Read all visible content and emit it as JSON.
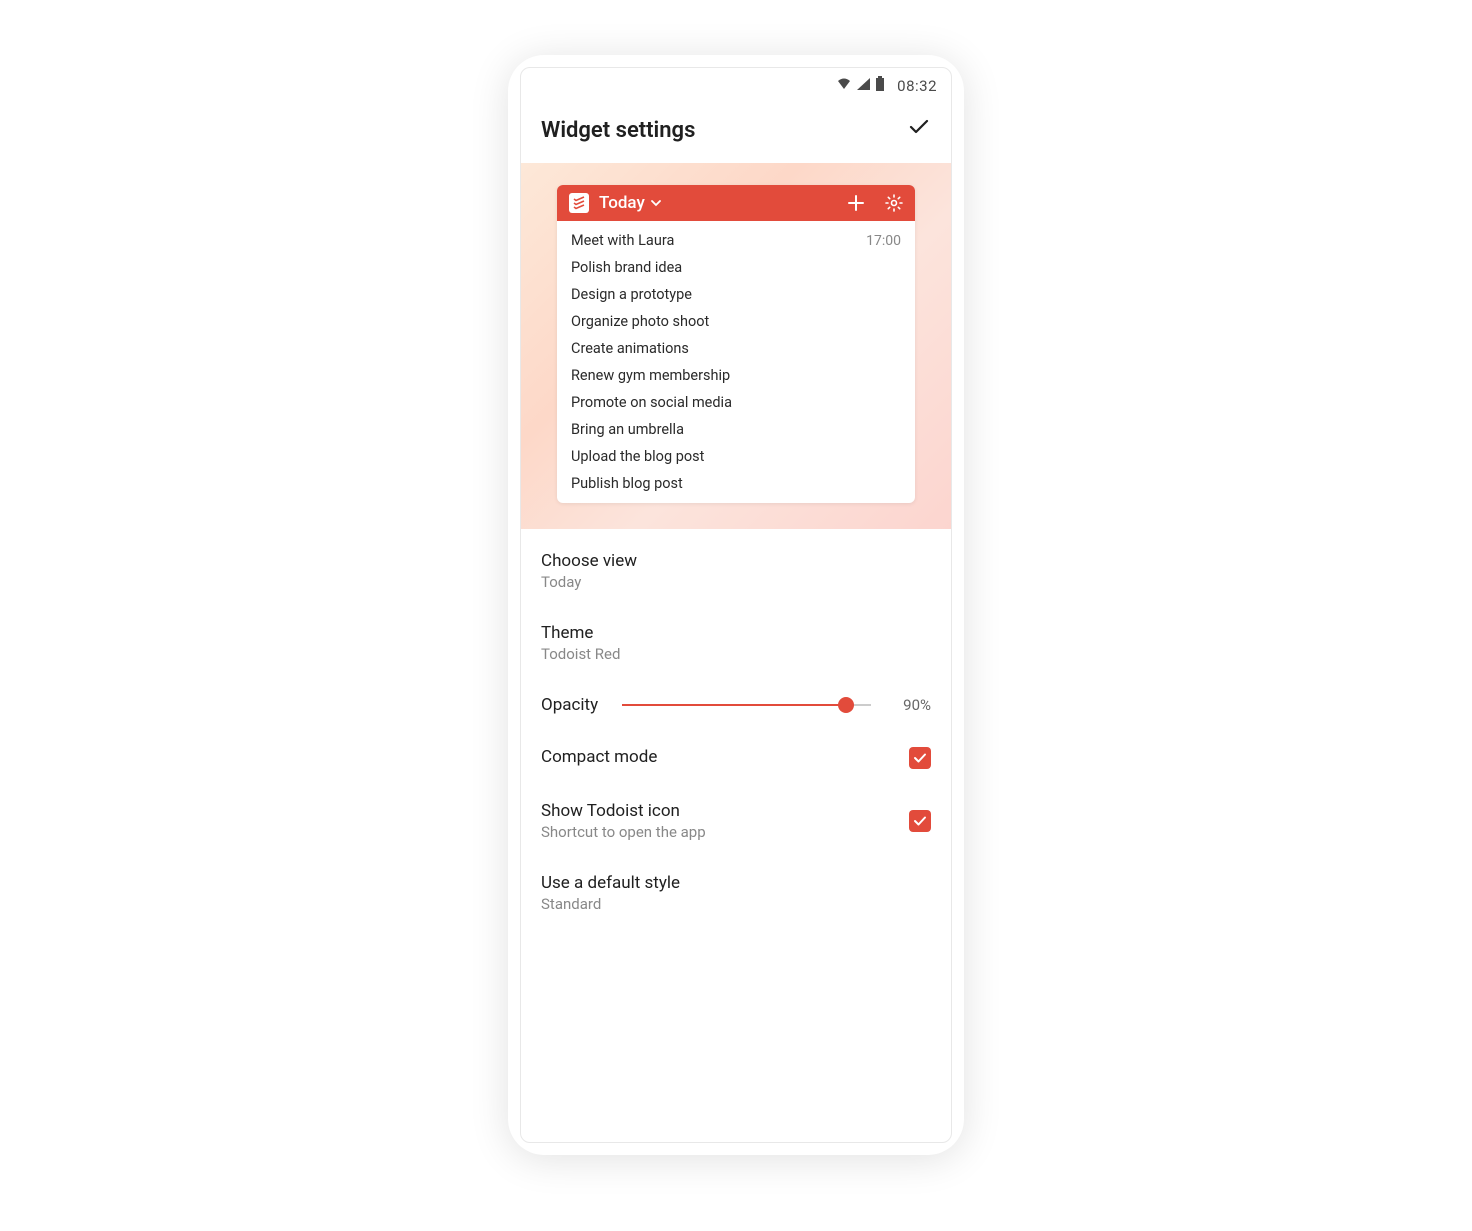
{
  "status_bar": {
    "time": "08:32"
  },
  "header": {
    "title": "Widget settings"
  },
  "widget": {
    "view_label": "Today",
    "tasks": [
      {
        "title": "Meet with Laura",
        "time": "17:00"
      },
      {
        "title": "Polish brand idea",
        "time": ""
      },
      {
        "title": "Design a prototype",
        "time": ""
      },
      {
        "title": "Organize photo shoot",
        "time": ""
      },
      {
        "title": "Create animations",
        "time": ""
      },
      {
        "title": "Renew gym membership",
        "time": ""
      },
      {
        "title": "Promote on social media",
        "time": ""
      },
      {
        "title": "Bring an umbrella",
        "time": ""
      },
      {
        "title": "Upload the blog post",
        "time": ""
      },
      {
        "title": "Publish blog post",
        "time": ""
      }
    ]
  },
  "settings": {
    "choose_view": {
      "label": "Choose view",
      "value": "Today"
    },
    "theme": {
      "label": "Theme",
      "value": "Todoist Red"
    },
    "opacity": {
      "label": "Opacity",
      "percent": 90,
      "display": "90%"
    },
    "compact_mode": {
      "label": "Compact mode",
      "checked": true
    },
    "show_icon": {
      "label": "Show Todoist icon",
      "subtitle": "Shortcut to open the app",
      "checked": true
    },
    "default_style": {
      "label": "Use a default style",
      "value": "Standard"
    }
  },
  "colors": {
    "accent": "#e24b3b"
  }
}
